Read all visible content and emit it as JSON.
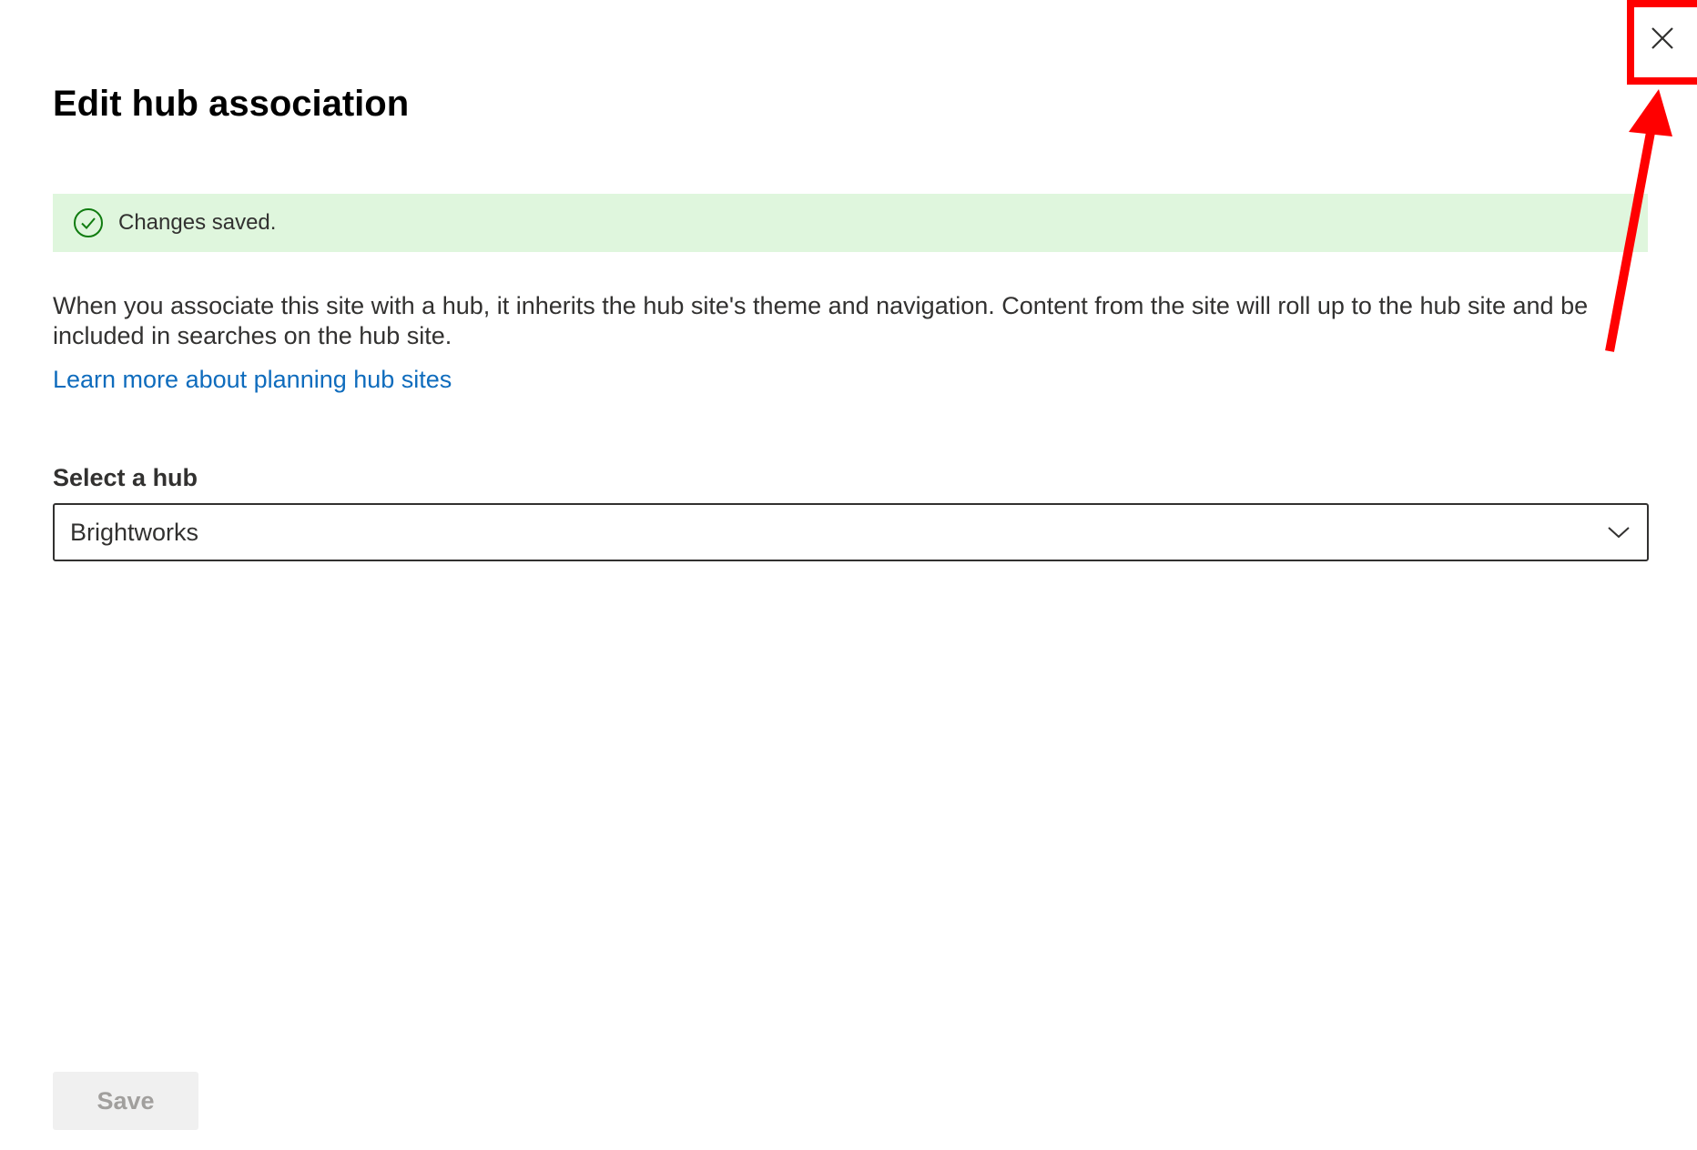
{
  "panel": {
    "title": "Edit hub association",
    "close_icon": "close-icon"
  },
  "banner": {
    "icon": "check-circle-icon",
    "text": "Changes saved.",
    "background": "#dff6dd",
    "icon_color": "#107c10"
  },
  "description": {
    "text": "When you associate this site with a hub, it inherits the hub site's theme and navigation. Content from the site will roll up to the hub site and be included in searches on the hub site.",
    "link_text": "Learn more about planning hub sites",
    "link_color": "#0f6cbd"
  },
  "hub_select": {
    "label": "Select a hub",
    "selected_value": "Brightworks",
    "chevron_icon": "chevron-down-icon"
  },
  "footer": {
    "save_label": "Save",
    "save_disabled": true
  },
  "annotation": {
    "color": "#ff0000"
  }
}
